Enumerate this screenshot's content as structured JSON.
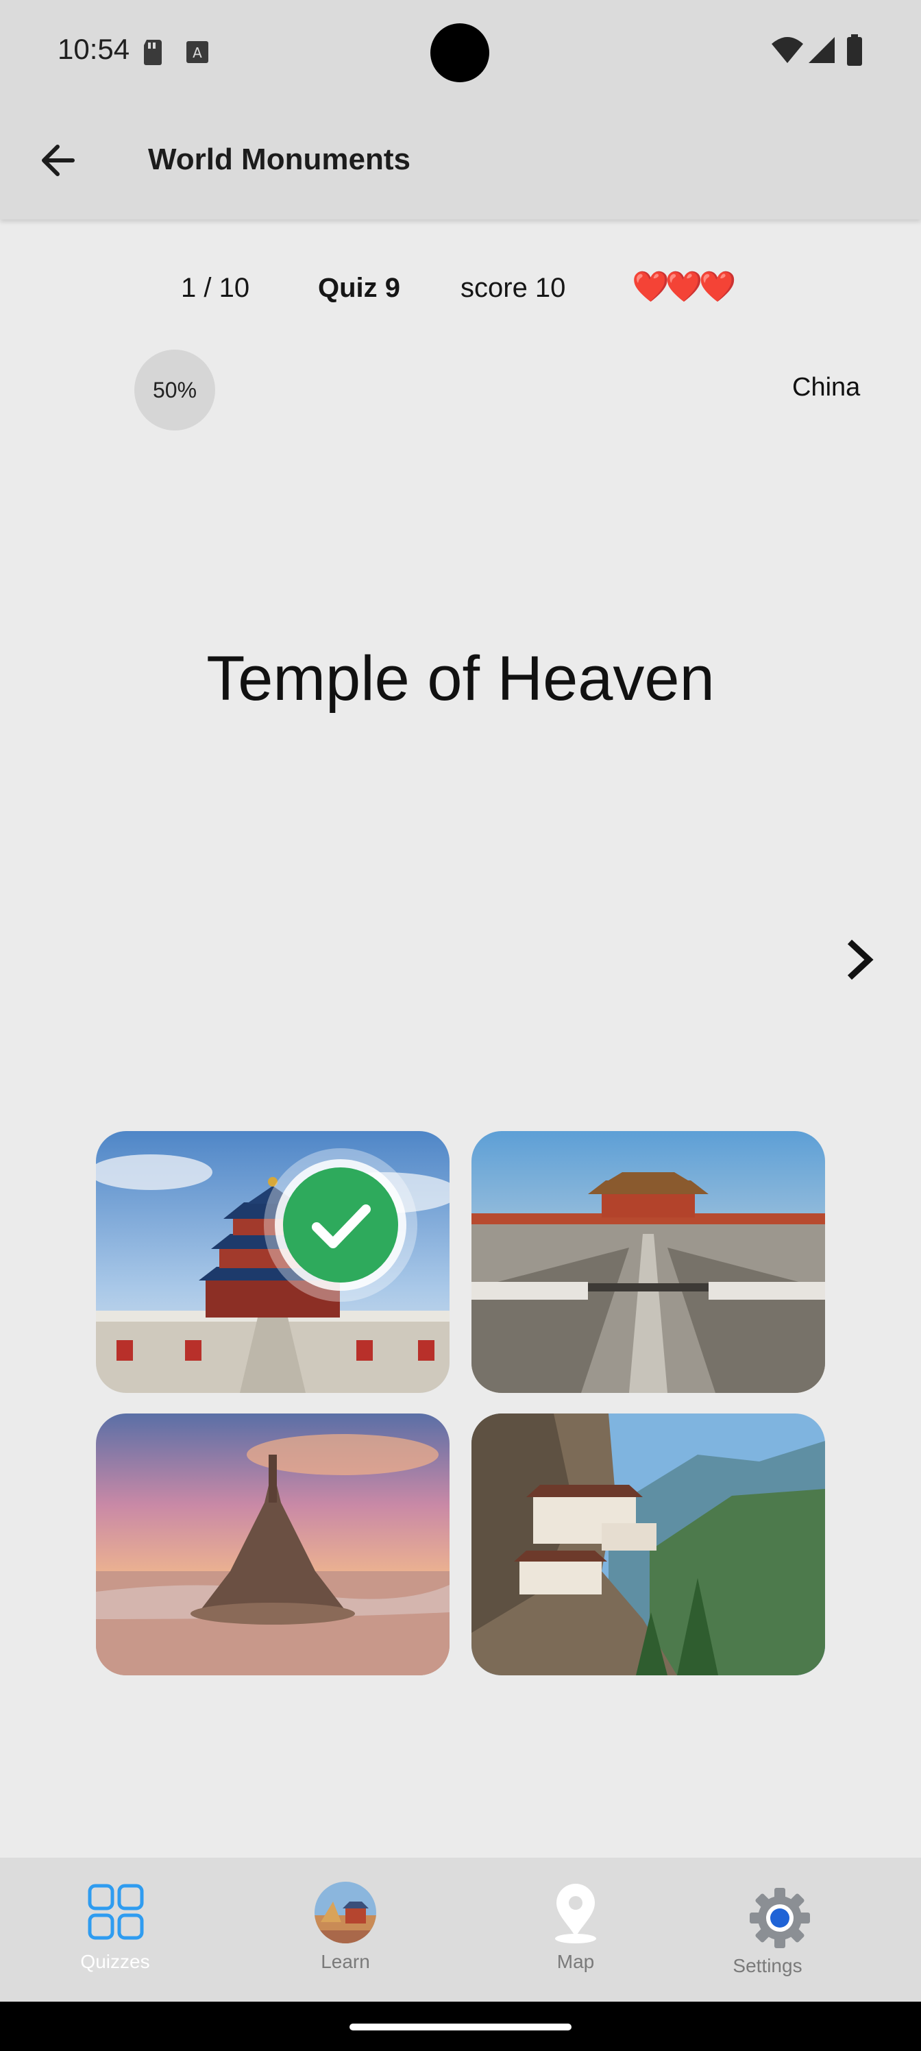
{
  "status_bar": {
    "time": "10:54"
  },
  "app_bar": {
    "title": "World Monuments"
  },
  "quiz_header": {
    "progress_count": "1 / 10",
    "quiz_name": "Quiz 9",
    "score": "score 10",
    "lives": "❤️❤️❤️"
  },
  "question": {
    "percent": "50%",
    "country": "China",
    "monument": "Temple of Heaven"
  },
  "answers": [
    {
      "image": "temple-of-heaven",
      "state": "correct"
    },
    {
      "image": "forbidden-city",
      "state": "none"
    },
    {
      "image": "mont-saint-michel",
      "state": "none"
    },
    {
      "image": "tigers-nest-monastery",
      "state": "none"
    }
  ],
  "bottom_nav": {
    "items": [
      {
        "label": "Quizzes",
        "icon": "grid-icon",
        "selected": true
      },
      {
        "label": "Learn",
        "icon": "monuments-thumbnail-icon",
        "selected": false
      },
      {
        "label": "Map",
        "icon": "map-pin-icon",
        "selected": false
      },
      {
        "label": "Settings",
        "icon": "gear-icon",
        "selected": false
      }
    ]
  },
  "colors": {
    "accent": "#2f9cf0",
    "correct": "#2eaa5c",
    "heart": "#d31c1c"
  }
}
